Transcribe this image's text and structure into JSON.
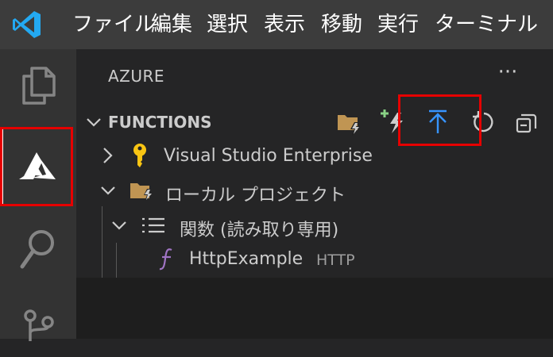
{
  "menubar": {
    "items": [
      "ファイル",
      "編集",
      "選択",
      "表示",
      "移動",
      "実行",
      "ターミナル"
    ]
  },
  "activitybar": {
    "items": [
      {
        "icon": "files-icon",
        "label": "Explorer"
      },
      {
        "icon": "azure-icon",
        "label": "Azure"
      },
      {
        "icon": "search-icon",
        "label": "Search"
      },
      {
        "icon": "source-control-icon",
        "label": "Source Control"
      }
    ]
  },
  "sidebar": {
    "title": "AZURE",
    "more_actions": "···",
    "section": {
      "title": "FUNCTIONS",
      "toolbar": [
        "folder-lightning-icon",
        "create-function-icon",
        "deploy-upload-icon",
        "refresh-icon",
        "collapse-all-icon"
      ]
    },
    "tree": {
      "subscription": "Visual Studio Enterprise",
      "local_project": "ローカル プロジェクト",
      "functions_folder": "関数 (読み取り専用)",
      "function_name": "HttpExample",
      "function_trigger": "HTTP"
    }
  },
  "colors": {
    "menubar_bg": "#3c3c3c",
    "activitybar_bg": "#333333",
    "sidebar_bg": "#252526",
    "highlight_red": "#e60000",
    "deploy_blue": "#3794ff",
    "key_yellow": "#f9c513",
    "folder_tan": "#c09553",
    "function_purple": "#a074c4"
  }
}
